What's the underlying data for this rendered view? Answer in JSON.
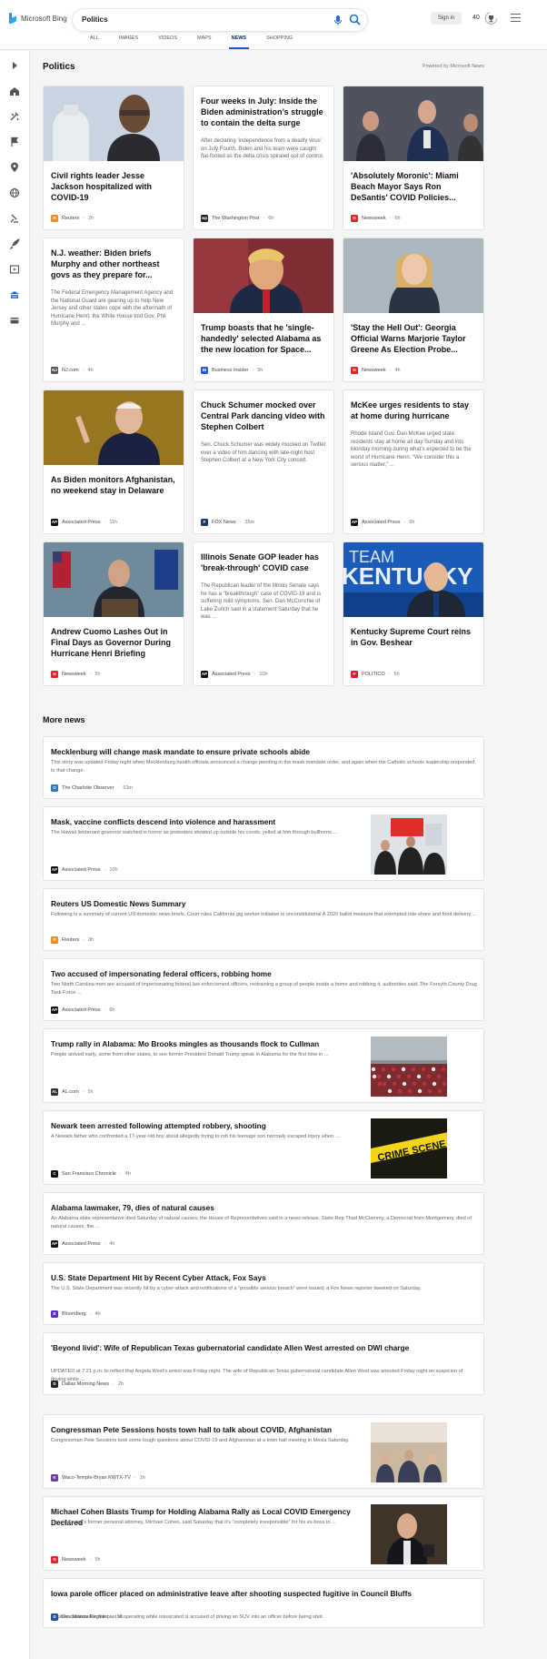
{
  "header": {
    "brand": "Microsoft Bing",
    "query": "Politics",
    "signin": "Sign in",
    "points": "40",
    "scopes": [
      "ALL",
      "IMAGES",
      "VIDEOS",
      "MAPS",
      "NEWS",
      "SHOPPING"
    ],
    "active_scope": "NEWS"
  },
  "rail_icons": [
    "expand-icon",
    "home-icon",
    "tools-icon",
    "flag-icon",
    "location-icon",
    "globe-icon",
    "science-icon",
    "rocket-icon",
    "video-icon",
    "politics-icon",
    "card-icon"
  ],
  "section": {
    "title": "Politics",
    "powered": "Powered by Microsoft News"
  },
  "cards": [
    {
      "title": "Civil rights leader Jesse Jackson hospitalized with COVID-19",
      "snippet": "",
      "source": "Reuters",
      "time": "2h",
      "logo": "R",
      "logo_color": "#f08a24",
      "img": "jackson"
    },
    {
      "title": "Four weeks in July: Inside the Biden administration’s struggle to contain the delta surge",
      "snippet": "After declaring ‘independence from a deadly virus’ on July Fourth, Biden and his team were caught flat-footed as the delta crisis spiraled out of control.",
      "source": "The Washington Post",
      "time": "6h",
      "logo": "wp",
      "logo_color": "#222",
      "img": ""
    },
    {
      "title": "'Absolutely Moronic': Miami Beach Mayor Says Ron DeSantis' COVID Policies...",
      "snippet": "",
      "source": "Newsweek",
      "time": "6h",
      "logo": "N",
      "logo_color": "#e4232b",
      "img": "desantis"
    },
    {
      "title": "N.J. weather: Biden briefs Murphy and other northeast govs as they prepare for...",
      "snippet": "The Federal Emergency Management Agency and the National Guard are gearing up to help New Jersey and other states cope with the aftermath of Hurricane Henri, the White House told Gov. Phil Murphy and ...",
      "source": "NJ.com",
      "time": "4h",
      "logo": "NJ",
      "logo_color": "#555",
      "img": ""
    },
    {
      "title": "Trump boasts that he 'single-handedly' selected Alabama as the new location for Space...",
      "snippet": "",
      "source": "Business Insider",
      "time": "5h",
      "logo": "BI",
      "logo_color": "#2457d6",
      "img": "trump"
    },
    {
      "title": "'Stay the Hell Out': Georgia Official Warns Marjorie Taylor Greene As Election Probe...",
      "snippet": "",
      "source": "Newsweek",
      "time": "4h",
      "logo": "N",
      "logo_color": "#e4232b",
      "img": "greene"
    },
    {
      "title": "As Biden monitors Afghanistan, no weekend stay in Delaware",
      "snippet": "",
      "source": "Associated Press",
      "time": "11h",
      "logo": "AP",
      "logo_color": "#111",
      "img": "biden"
    },
    {
      "title": "Chuck Schumer mocked over Central Park dancing video with Stephen Colbert",
      "snippet": "Sen. Chuck Schumer was widely mocked on Twitter over a video of him dancing with late-night host Stephen Colbert at a New York City concert.",
      "source": "FOX News",
      "time": "35m",
      "logo": "F",
      "logo_color": "#1b3a6b",
      "img": ""
    },
    {
      "title": "McKee urges residents to stay at home during hurricane",
      "snippet": "Rhode Island Gov. Dan McKee urged state residents stay at home all day Sunday and into Monday morning during what’s expected to be the worst of Hurricane Henri. “We consider this a serious matter,” ...",
      "source": "Associated Press",
      "time": "6h",
      "logo": "AP",
      "logo_color": "#111",
      "img": ""
    },
    {
      "title": "Andrew Cuomo Lashes Out in Final Days as Governor During Hurricane Henri Briefing",
      "snippet": "",
      "source": "Newsweek",
      "time": "5h",
      "logo": "N",
      "logo_color": "#e4232b",
      "img": "cuomo"
    },
    {
      "title": "Illinois Senate GOP leader has 'break-through' COVID case",
      "snippet": "The Republican leader of the Illinois Senate says he has a “breakthrough” case of COVID-19 and is suffering mild symptoms. Sen. Dan McConchie of Lake Zurich said in a statement Saturday that he was ...",
      "source": "Associated Press",
      "time": "10h",
      "logo": "AP",
      "logo_color": "#111",
      "img": ""
    },
    {
      "title": "Kentucky Supreme Court reins in Gov. Beshear",
      "snippet": "",
      "source": "POLITICO",
      "time": "5h",
      "logo": "P",
      "logo_color": "#d71f2a",
      "img": "kentucky",
      "img_text": "TEAM KENTUCKY"
    }
  ],
  "more_title": "More news",
  "more": [
    {
      "title": "Mecklenburg will change mask mandate to ensure private schools abide",
      "snippet": "This story was updated Friday night when Mecklenburg health officials announced a change pending in the mask mandate order, and again when the Catholic schools leadership responded to that change.",
      "source": "The Charlotte Observer",
      "time": "53m",
      "logo": "O",
      "logo_color": "#2a78c2",
      "thumb": ""
    },
    {
      "title": "Mask, vaccine conflicts descend into violence and harassment",
      "snippet": "The Hawaii lieutenant governor watched in horror as protesters showed up outside his condo, yelled at him through bullhorns ...",
      "source": "Associated Press",
      "time": "10h",
      "logo": "AP",
      "logo_color": "#111",
      "thumb": "protest"
    },
    {
      "title": "Reuters US Domestic News Summary",
      "snippet": "Following is a summary of current US domestic news briefs. Court rules California gig worker initiative is unconstitutional A 2020 ballot measure that exempted ride-share and food delivery ...",
      "source": "Reuters",
      "time": "3h",
      "logo": "R",
      "logo_color": "#f08a24",
      "thumb": ""
    },
    {
      "title": "Two accused of impersonating federal officers, robbing home",
      "snippet": "Two North Carolina men are accused of impersonating federal law enforcement officers, restraining a group of people inside a home and robbing it, authorities said. The Forsyth County Drug Task Force ...",
      "source": "Associated Press",
      "time": "6h",
      "logo": "AP",
      "logo_color": "#111",
      "thumb": ""
    },
    {
      "title": "Trump rally in Alabama: Mo Brooks mingles as thousands flock to Cullman",
      "snippet": "People arrived early, some from other states, to see former President Donald Trump speak in Alabama for the first time in ...",
      "source": "AL.com",
      "time": "1h",
      "logo": "AL",
      "logo_color": "#333",
      "thumb": "rally"
    },
    {
      "title": "Newark teen arrested following attempted robbery, shooting",
      "snippet": "A Newark father who confronted a 17-year-old boy about allegedly trying to rob his teenage son narrowly escaped injury when ...",
      "source": "San Francisco Chronicle",
      "time": "4h",
      "logo": "C",
      "logo_color": "#111",
      "thumb": "crime"
    },
    {
      "title": "Alabama lawmaker, 79, dies of natural causes",
      "snippet": "An Alabama state representative died Saturday of natural causes, the House of Representatives said in a news release. State Rep Thad McClammy, a Democrat from Montgomery, died of natural causes, the ...",
      "source": "Associated Press",
      "time": "4h",
      "logo": "AP",
      "logo_color": "#111",
      "thumb": ""
    },
    {
      "title": "U.S. State Department Hit by Recent Cyber Attack, Fox Says",
      "snippet": "The U.S. State Department was recently hit by a cyber-attack and notifications of a “possible serious breach” were issued, a Fox News reporter tweeted on Saturday.",
      "source": "Bloomberg",
      "time": "4h",
      "logo": "B",
      "logo_color": "#5a2dd8",
      "thumb": ""
    },
    {
      "title": "'Beyond livid': Wife of Republican Texas gubernatorial candidate Allen West arrested on DWI charge",
      "snippet": "UPDATED at 7:21 p.m. to reflect that Angela West's arrest was Friday night. The wife of Republican Texas gubernatorial candidate Allen West was arrested Friday night on suspicion of driving while ...",
      "source": "Dallas Morning News",
      "time": "2h",
      "logo": "D",
      "logo_color": "#222",
      "thumb": ""
    },
    {
      "title": "Congressman Pete Sessions hosts town hall to talk about COVID, Afghanistan",
      "snippet": "Congressman Pete Sessions took some tough questions about COVID-19 and Afghanistan at a town hall meeting in Mexia Saturday.",
      "source": "Waco-Temple-Bryan KWTX-TV",
      "time": "1h",
      "logo": "K",
      "logo_color": "#6b3fa0",
      "thumb": "townhall"
    },
    {
      "title": "Michael Cohen Blasts Trump for Holding Alabama Rally as Local COVID Emergency Declared",
      "snippet": "Donald Trump's former personal attorney, Michael Cohen, said Saturday that it's \"completely irresponsible\" for his ex-boss to ...",
      "source": "Newsweek",
      "time": "5h",
      "logo": "N",
      "logo_color": "#e4232b",
      "thumb": "cohen"
    },
    {
      "title": "Iowa parole officer placed on administrative leave after shooting suspected fugitive in Council Bluffs",
      "snippet": "Fugitive convicted in the past of operating while intoxicated is accused of driving an SUV into an officer before being shot.",
      "source": "Des Moines Register",
      "time": "5h",
      "logo": "D",
      "logo_color": "#2a4f9a",
      "thumb": ""
    }
  ]
}
